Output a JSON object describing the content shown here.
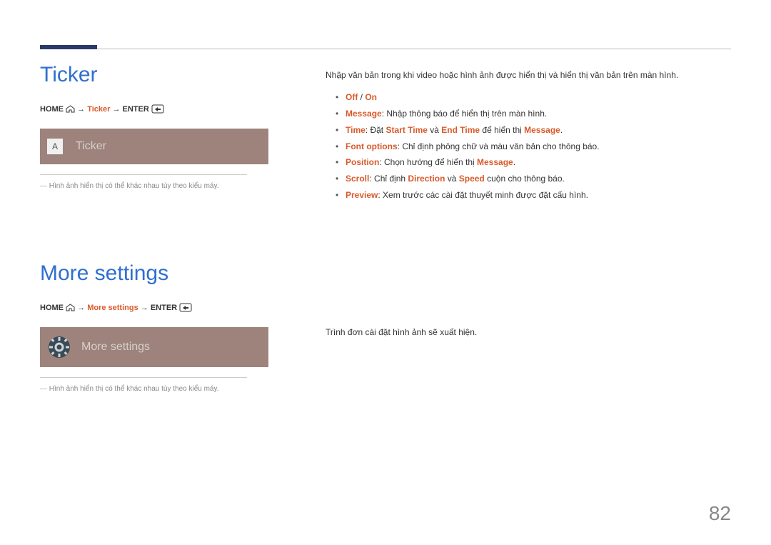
{
  "page_number": "82",
  "sections": {
    "ticker": {
      "heading": "Ticker",
      "breadcrumb": {
        "home": "HOME",
        "item": "Ticker",
        "enter": "ENTER"
      },
      "tile_badge": "A",
      "tile_label": "Ticker",
      "note": "Hình ảnh hiển thị có thể khác nhau tùy theo kiểu máy.",
      "lead": "Nhập văn bản trong khi video hoặc hình ảnh được hiển thị và hiển thị văn bản trên màn hình.",
      "bullets": {
        "off_on": {
          "off": "Off",
          "sep": " / ",
          "on": "On"
        },
        "message": {
          "label": "Message",
          "text": ": Nhập thông báo để hiển thị trên màn hình."
        },
        "time": {
          "label": "Time",
          "pre": ": Đặt ",
          "start": "Start Time",
          "mid": " và ",
          "end": "End Time",
          "post": " để hiển thị ",
          "msg": "Message",
          "tail": "."
        },
        "font": {
          "label": "Font options",
          "text": ": Chỉ định phông chữ và màu văn bản cho thông báo."
        },
        "position": {
          "label": "Position",
          "pre": ": Chọn hướng để hiển thị ",
          "msg": "Message",
          "tail": "."
        },
        "scroll": {
          "label": "Scroll",
          "pre": ": Chỉ định ",
          "dir": "Direction",
          "mid": " và ",
          "speed": "Speed",
          "tail": " cuộn cho thông báo."
        },
        "preview": {
          "label": "Preview",
          "text": ": Xem trước các cài đặt thuyết minh được đặt cấu hình."
        }
      }
    },
    "more": {
      "heading": "More settings",
      "breadcrumb": {
        "home": "HOME",
        "item": "More settings",
        "enter": "ENTER"
      },
      "tile_label": "More settings",
      "note": "Hình ảnh hiển thị có thể khác nhau tùy theo kiểu máy.",
      "lead": "Trình đơn cài đặt hình ảnh sẽ xuất hiện."
    }
  }
}
